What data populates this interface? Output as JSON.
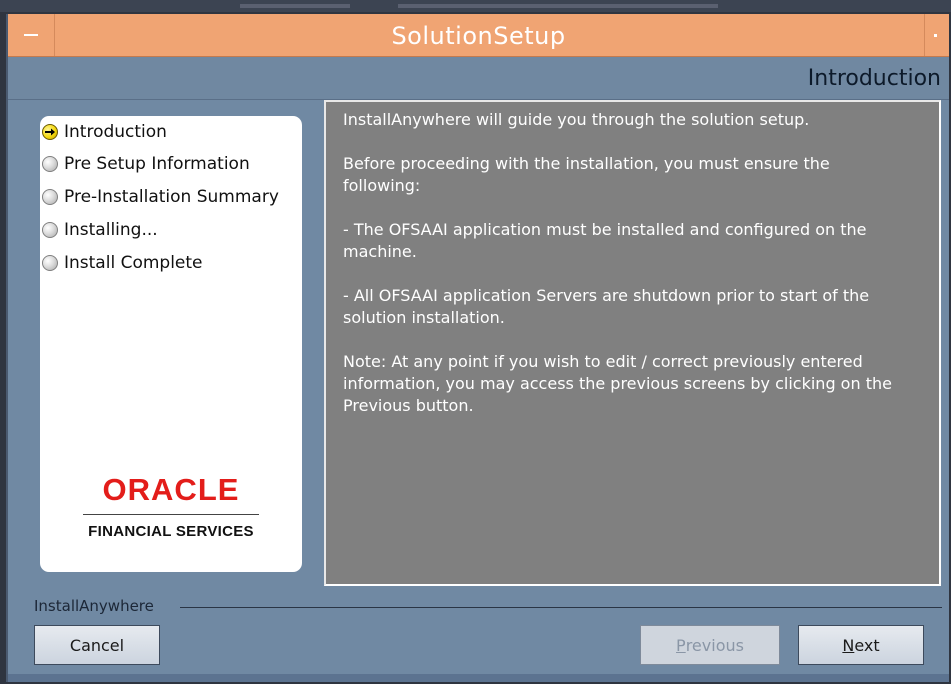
{
  "window": {
    "title": "SolutionSetup"
  },
  "header": {
    "title": "Introduction"
  },
  "steps": [
    {
      "label": "Introduction",
      "state": "current"
    },
    {
      "label": "Pre Setup Information",
      "state": "pending"
    },
    {
      "label": "Pre-Installation Summary",
      "state": "pending"
    },
    {
      "label": "Installing...",
      "state": "pending"
    },
    {
      "label": "Install Complete",
      "state": "pending"
    }
  ],
  "logo": {
    "oracle": "ORACLE",
    "subtitle": "FINANCIAL SERVICES"
  },
  "content": {
    "paragraphs": [
      "InstallAnywhere will guide you through the solution setup.",
      "Before proceeding with the installation, you must ensure the following:",
      "- The OFSAAI application must be installed and configured on the machine.",
      "- All OFSAAI application Servers are shutdown prior to start of the solution installation.",
      "Note: At any point if you wish to edit / correct previously entered information, you may access the previous screens by clicking on the Previous button."
    ]
  },
  "footer": {
    "label": "InstallAnywhere",
    "cancel": "Cancel",
    "previous": "Previous",
    "next": "Next"
  },
  "colors": {
    "titlebar": "#f0a473",
    "window_bg": "#7089a3",
    "content_bg": "#808080",
    "oracle_red": "#e31d1a"
  }
}
